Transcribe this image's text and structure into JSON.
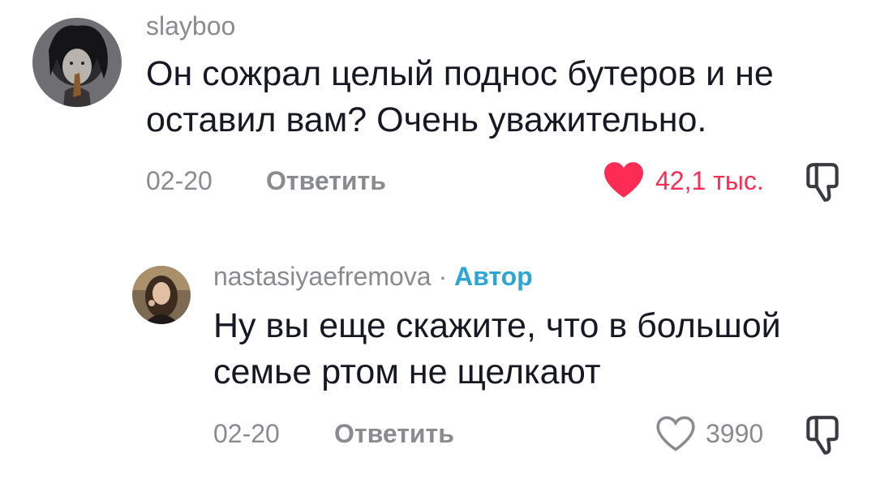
{
  "comments": [
    {
      "username": "slayboo",
      "text_line1": "Он сожрал целый поднос бутеров и не",
      "text_line2": "оставил вам? Очень уважительно.",
      "date": "02-20",
      "reply_label": "Ответить",
      "likes": "42,1 тыс.",
      "liked": true
    }
  ],
  "replies": [
    {
      "username": "nastasiyaefremova",
      "separator": "·",
      "author_badge": "Автор",
      "text_line1": "Ну вы еще скажите, что в большой",
      "text_line2": "семье ртом не щелкают",
      "date": "02-20",
      "reply_label": "Ответить",
      "likes": "3990",
      "liked": false
    }
  ],
  "colors": {
    "liked": "#fe2c55",
    "muted": "#8a8b91",
    "author": "#2ba6d6",
    "text": "#161823"
  },
  "icons": {
    "like": "heart-icon",
    "dislike": "thumbs-down-icon"
  }
}
